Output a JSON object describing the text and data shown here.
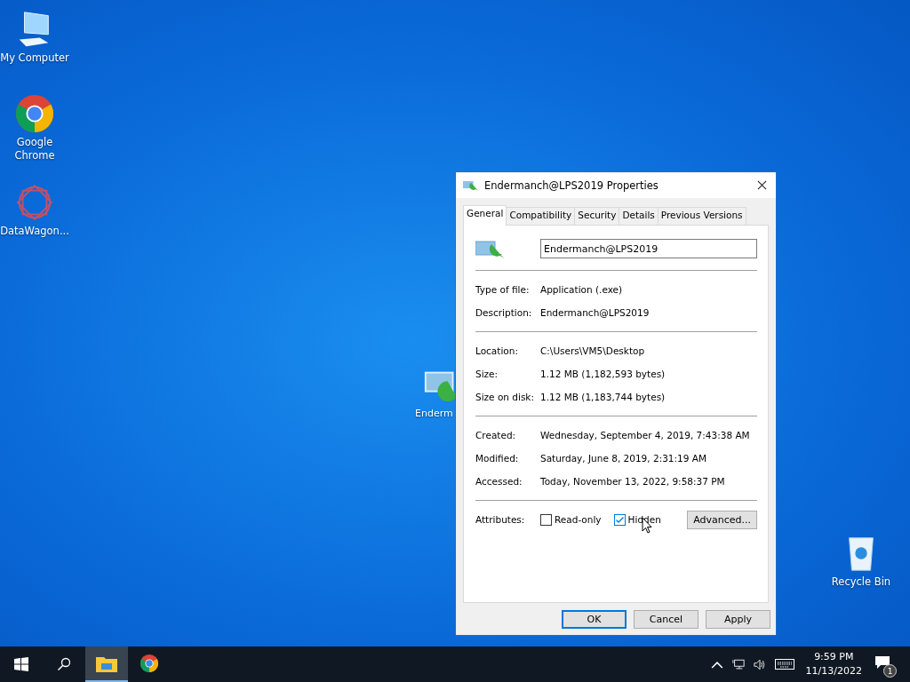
{
  "desktop_icons": [
    {
      "label": "My Computer",
      "kind": "computer"
    },
    {
      "label": "Google Chrome",
      "kind": "chrome"
    },
    {
      "label": "DataWagon...",
      "kind": "datawagon"
    },
    {
      "label": "Enderm",
      "kind": "app"
    },
    {
      "label": "Recycle Bin",
      "kind": "recycle"
    }
  ],
  "dialog": {
    "title": "Endermanch@LPS2019 Properties",
    "tabs": [
      {
        "label": "General",
        "selected": true
      },
      {
        "label": "Compatibility",
        "selected": false
      },
      {
        "label": "Security",
        "selected": false
      },
      {
        "label": "Details",
        "selected": false
      },
      {
        "label": "Previous Versions",
        "selected": false
      }
    ],
    "name_value": "Endermanch@LPS2019",
    "sections": [
      [
        {
          "label": "Type of file:",
          "value": "Application (.exe)"
        },
        {
          "label": "Description:",
          "value": "Endermanch@LPS2019"
        }
      ],
      [
        {
          "label": "Location:",
          "value": "C:\\Users\\VM5\\Desktop"
        },
        {
          "label": "Size:",
          "value": "1.12 MB (1,182,593 bytes)"
        },
        {
          "label": "Size on disk:",
          "value": "1.12 MB (1,183,744 bytes)"
        }
      ],
      [
        {
          "label": "Created:",
          "value": "Wednesday, September 4, 2019, 7:43:38 AM"
        },
        {
          "label": "Modified:",
          "value": "Saturday, June 8, 2019, 2:31:19 AM"
        },
        {
          "label": "Accessed:",
          "value": "Today, November 13, 2022, 9:58:37 PM"
        }
      ]
    ],
    "attributes": {
      "label": "Attributes:",
      "items": [
        {
          "label": "Read-only",
          "checked": false
        },
        {
          "label": "Hidden",
          "checked": true
        }
      ],
      "advanced": "Advanced..."
    },
    "buttons": [
      {
        "label": "OK",
        "default": true
      },
      {
        "label": "Cancel",
        "default": false
      },
      {
        "label": "Apply",
        "default": false
      }
    ]
  },
  "taskbar": {
    "apps": [
      {
        "kind": "explorer",
        "active": true
      },
      {
        "kind": "chrome",
        "active": false
      }
    ],
    "time": "9:59 PM",
    "date": "11/13/2022",
    "notifications": "1"
  }
}
